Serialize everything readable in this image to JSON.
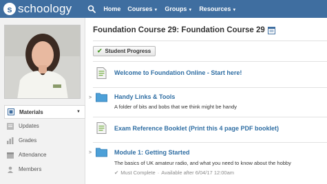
{
  "nav": {
    "logo_letter": "s",
    "logo_text": "schoology",
    "items": [
      {
        "label": "Home",
        "dropdown": false
      },
      {
        "label": "Courses",
        "dropdown": true
      },
      {
        "label": "Groups",
        "dropdown": true
      },
      {
        "label": "Resources",
        "dropdown": true
      }
    ]
  },
  "sidebar": {
    "items": [
      {
        "label": "Materials",
        "icon": "materials-icon",
        "active": true
      },
      {
        "label": "Updates",
        "icon": "updates-icon",
        "active": false
      },
      {
        "label": "Grades",
        "icon": "grades-icon",
        "active": false
      },
      {
        "label": "Attendance",
        "icon": "attendance-icon",
        "active": false
      },
      {
        "label": "Members",
        "icon": "members-icon",
        "active": false
      }
    ]
  },
  "main": {
    "course_title": "Foundation Course 29: Foundation Course 29",
    "progress_button": "Student Progress",
    "materials": [
      {
        "type": "page",
        "title": "Welcome to Foundation Online - Start here!"
      },
      {
        "type": "folder",
        "title": "Handy Links & Tools",
        "description": "A folder of bits and bobs that we think might be handy"
      },
      {
        "type": "page",
        "title": "Exam Reference Booklet (Print this 4 page PDF booklet)"
      },
      {
        "type": "folder",
        "title": "Module 1: Getting Started",
        "description": "The basics of UK amateur radio, and what you need to know about the hobby",
        "meta_status": "Must Complete",
        "meta_separator": "·",
        "meta_available": "Available after 6/04/17 12:00am"
      }
    ]
  },
  "colors": {
    "nav_bg": "#3f6ea0",
    "link": "#2f6ea3",
    "folder": "#4da0d8",
    "check": "#4c9a2a"
  }
}
